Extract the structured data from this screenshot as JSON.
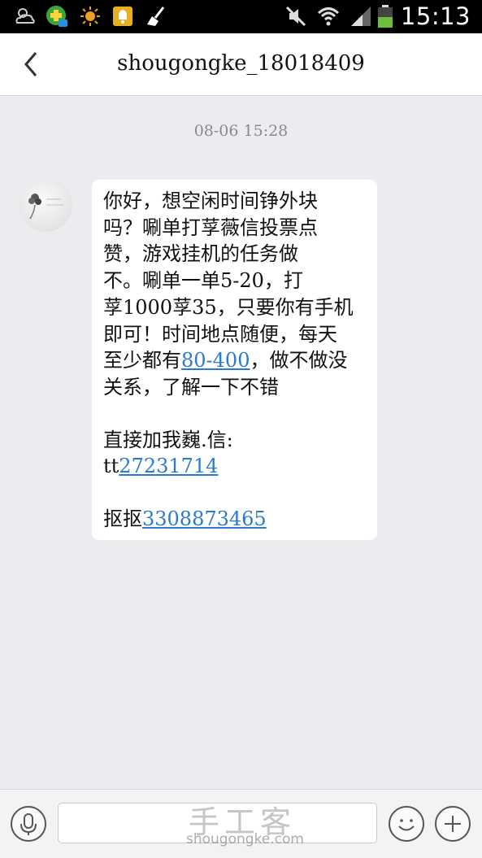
{
  "status_bar": {
    "time": "15:13",
    "icons": [
      "weather-cloud-icon",
      "app-notification-icon",
      "sun-icon",
      "notification-icon",
      "cleaner-icon",
      "mute-icon",
      "wifi-icon",
      "signal-icon",
      "battery-icon"
    ]
  },
  "header": {
    "title": "shougongke_18018409",
    "back_icon": "chevron-left-icon"
  },
  "chat": {
    "timestamp": "08-06 15:28",
    "message": {
      "lines": [
        "你好，想空闲时间铮外块",
        "吗？唰单打莩薇信投票点",
        "赞，游戏挂机的任务做",
        "不。唰单一单5-20，打",
        "莩1000莩35，只要你有手机",
        "即可！时间地点随便，每天"
      ],
      "line7_prefix": "至少都有",
      "line7_link": "80-400",
      "line7_suffix": "，做不做没",
      "line8": "关系，了解一下不错",
      "contact_label": "直接加我巍.信:",
      "wechat_prefix": "tt",
      "wechat_link": "27231714",
      "qq_prefix": "抠抠",
      "qq_link": "3308873465"
    }
  },
  "input_bar": {
    "voice_icon": "microphone-icon",
    "emoji_icon": "smiley-icon",
    "add_icon": "plus-icon",
    "input_value": ""
  },
  "watermark": {
    "main": "手工客",
    "sub": "shougongke.com"
  },
  "colors": {
    "background": "#ebebf0",
    "link": "#2a7bd0",
    "status_bar": "#000000"
  }
}
